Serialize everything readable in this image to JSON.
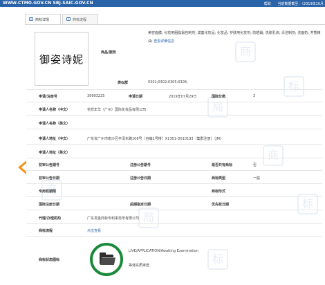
{
  "top_bar": {
    "url": "WWW.CTMO.GOV.CN SBJ.SAIC.GOV.CN",
    "help": "帮助",
    "current_data": "当前数据截至：（2019年10月"
  },
  "tabs": [
    {
      "label": "商标详情"
    },
    {
      "label": "商标流程"
    }
  ],
  "trademark": {
    "image_text": "御姿诗妮",
    "goods_label": "商品/服务",
    "goods_value": "美容面膜; 化妆用胭脂霜自制剂; 成套化妆品; 化妆品; 护肤用化妆剂; 防晒霜; 洗肤乳液; 清洁制剂; 洗面奶; 芳香精油;",
    "goods_link": "查看详细信息",
    "group_label": "类似群",
    "group_value": "0301;0302;0305;0306;"
  },
  "fields": {
    "reg_no_label": "申请/注册号",
    "reg_no": "39993225",
    "app_date_label": "申请日期",
    "app_date": "2019年07月29日",
    "intl_class_label": "国际分类",
    "intl_class": "3",
    "applicant_cn_label": "申请人名称（中文）",
    "applicant_cn": "花样年华（广州）国际化妆品有限公司",
    "applicant_en_label": "申请人名称（英文）",
    "address_cn_label": "申请人地址（中文）",
    "address_cn": "广东省广州市南沙区丰泽东路106号（自编1号楼）X1301-D010193（集群注册）（JM）",
    "address_en_label": "申请人地址（英文）",
    "prelim_no_label": "初审公告期号",
    "reg_pub_no_label": "注册公告期号",
    "shared_label": "是否共有商标",
    "shared": "否",
    "prelim_date_label": "初审公告日期",
    "reg_pub_date_label": "注册公告日期",
    "mark_type_label": "商标类型",
    "mark_type": "一般",
    "exclusive_label": "专用权期限",
    "mark_form_label": "商标形式",
    "intl_reg_date_label": "国际注册日期",
    "later_date_label": "后期指定日期",
    "priority_date_label": "优先权日期",
    "agency_label": "代理/办理机构",
    "agency": "广东发金商标专利事务所有限公司",
    "process_label": "商标流程",
    "process_link": "点击查看",
    "status_label": "商标状态图标",
    "status_en": "LIVE/APPLICATION/Awaiting Examination",
    "status_cn": "等待实质审查"
  },
  "colors": {
    "top_bar": "#2a63a8",
    "arrow": "#f2961e",
    "badge_ring": "#1a8a3a",
    "link": "#2a63a8"
  }
}
